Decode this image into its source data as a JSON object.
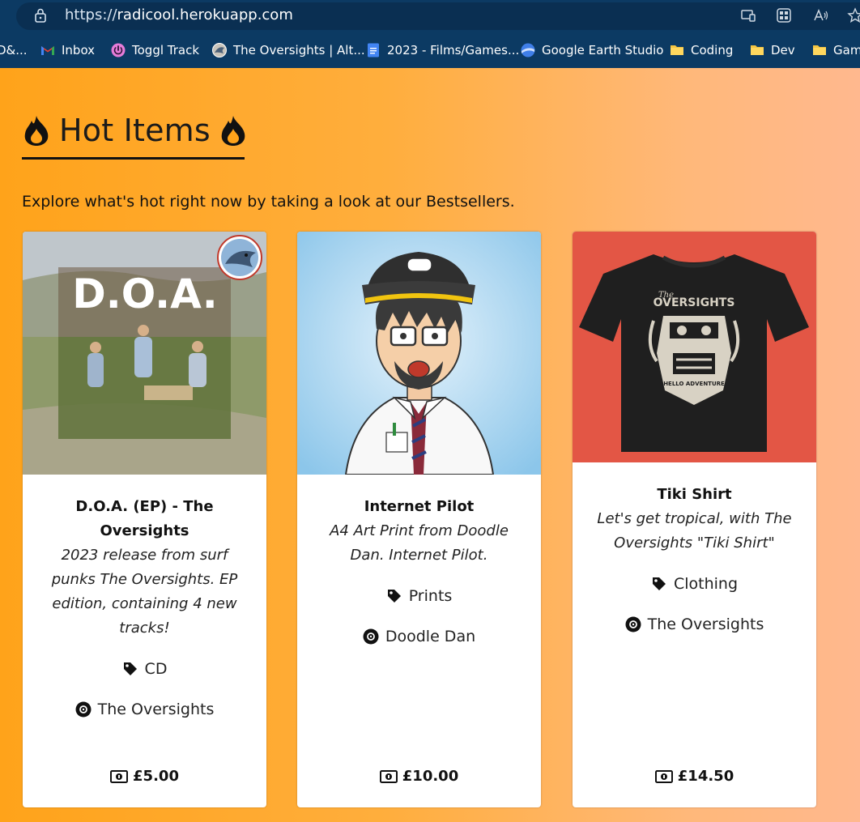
{
  "browser": {
    "url_scheme": "https://",
    "url_host": "radicool.herokuapp.com",
    "bookmarks": [
      {
        "label": "D&...",
        "icon": "partial-icon"
      },
      {
        "label": "Inbox",
        "icon": "gmail-icon"
      },
      {
        "label": "Toggl Track",
        "icon": "toggl-icon"
      },
      {
        "label": "The Oversights | Alt...",
        "icon": "site-favicon-icon"
      },
      {
        "label": "2023 - Films/Games...",
        "icon": "google-docs-icon"
      },
      {
        "label": "Google Earth Studio",
        "icon": "earth-icon"
      },
      {
        "label": "Coding",
        "icon": "folder-icon"
      },
      {
        "label": "Dev",
        "icon": "folder-icon"
      },
      {
        "label": "Gam",
        "icon": "folder-icon"
      }
    ]
  },
  "page": {
    "heading": "Hot Items",
    "intro": "Explore what's hot right now by taking a look at our Bestsellers."
  },
  "products": [
    {
      "title": "D.O.A. (EP) - The Oversights",
      "description": "2023 release from surf punks The Oversights. EP edition, containing 4 new tracks!",
      "category": "CD",
      "artist": "The Oversights",
      "price": "£5.00",
      "image_text": "D.O.A."
    },
    {
      "title": "Internet Pilot",
      "description": "A4 Art Print from Doodle Dan. Internet Pilot.",
      "category": "Prints",
      "artist": "Doodle Dan",
      "price": "£10.00"
    },
    {
      "title": "Tiki Shirt",
      "description": "Let's get tropical, with The Oversights \"Tiki Shirt\"",
      "category": "Clothing",
      "artist": "The Oversights",
      "price": "£14.50",
      "image_text_top": "The",
      "image_text_main": "OVERSIGHTS",
      "image_text_bottom": "HELLO ADVENTURE"
    }
  ],
  "colors": {
    "chrome": "#0c3a63",
    "page_orange": "#ffa31a",
    "page_peach": "#ffb88e",
    "tshirt_bg": "#e35645"
  }
}
